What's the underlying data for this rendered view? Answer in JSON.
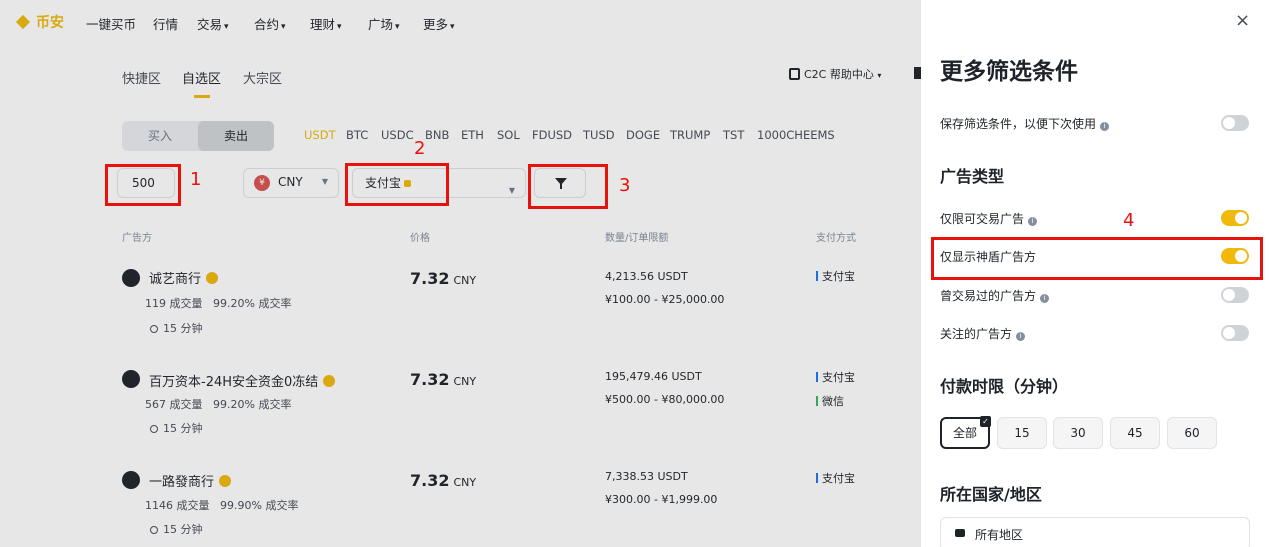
{
  "nav": {
    "brand": "币安",
    "items": [
      {
        "label": "一键买币",
        "dropdown": false
      },
      {
        "label": "行情",
        "dropdown": false
      },
      {
        "label": "交易",
        "dropdown": true
      },
      {
        "label": "合约",
        "dropdown": true
      },
      {
        "label": "理财",
        "dropdown": true
      },
      {
        "label": "广场",
        "dropdown": true
      },
      {
        "label": "更多",
        "dropdown": true
      }
    ]
  },
  "zone_tabs": [
    "快捷区",
    "自选区",
    "大宗区"
  ],
  "active_zone": "自选区",
  "help_center": "C2C 帮助中心",
  "trade_side": {
    "buy": "买入",
    "sell": "卖出",
    "selected": "卖出"
  },
  "coins": [
    "USDT",
    "BTC",
    "USDC",
    "BNB",
    "ETH",
    "SOL",
    "FDUSD",
    "TUSD",
    "DOGE",
    "TRUMP",
    "TST",
    "1000CHEEMS"
  ],
  "active_coin": "USDT",
  "filters": {
    "amount": "500",
    "currency": "CNY",
    "currency_symbol": "¥",
    "payment": "支付宝"
  },
  "annotations": [
    "1",
    "2",
    "3",
    "4"
  ],
  "table_headers": [
    "广告方",
    "价格",
    "数量/订单限额",
    "支付方式"
  ],
  "ads": [
    {
      "name": "诚艺商行",
      "orders": "119 成交量",
      "rate": "99.20% 成交率",
      "time": "15 分钟",
      "price": "7.32",
      "currency": "CNY",
      "amount": "4,213.56 USDT",
      "limit": "¥100.00 - ¥25,000.00",
      "payments": [
        {
          "label": "支付宝",
          "color": "#1677ff"
        }
      ]
    },
    {
      "name": "百万资本-24H安全资金0冻结",
      "orders": "567 成交量",
      "rate": "99.20% 成交率",
      "time": "15 分钟",
      "price": "7.32",
      "currency": "CNY",
      "amount": "195,479.46 USDT",
      "limit": "¥500.00 - ¥80,000.00",
      "payments": [
        {
          "label": "支付宝",
          "color": "#1677ff"
        },
        {
          "label": "微信",
          "color": "#2dbb55"
        }
      ]
    },
    {
      "name": "一路發商行",
      "orders": "1146 成交量",
      "rate": "99.90% 成交率",
      "time": "15 分钟",
      "price": "7.32",
      "currency": "CNY",
      "amount": "7,338.53 USDT",
      "limit": "¥300.00 - ¥1,999.00",
      "payments": [
        {
          "label": "支付宝",
          "color": "#1677ff"
        }
      ]
    }
  ],
  "drawer": {
    "close": "×",
    "title": "更多筛选条件",
    "save_filter": {
      "label": "保存筛选条件，以便下次使用",
      "on": false
    },
    "ad_type_heading": "广告类型",
    "ad_types": [
      {
        "label": "仅限可交易广告",
        "on": true,
        "info": true
      },
      {
        "label": "仅显示神盾广告方",
        "on": true,
        "info": false
      },
      {
        "label": "曾交易过的广告方",
        "on": false,
        "info": true
      },
      {
        "label": "关注的广告方",
        "on": false,
        "info": true
      }
    ],
    "payment_time_heading": "付款时限（分钟）",
    "payment_times": [
      "全部",
      "15",
      "30",
      "45",
      "60"
    ],
    "payment_time_selected": "全部",
    "country_heading": "所在国家/地区",
    "country_value": "所有地区"
  },
  "colors": {
    "accent": "#f0b90b",
    "highlight": "#e8120c"
  }
}
